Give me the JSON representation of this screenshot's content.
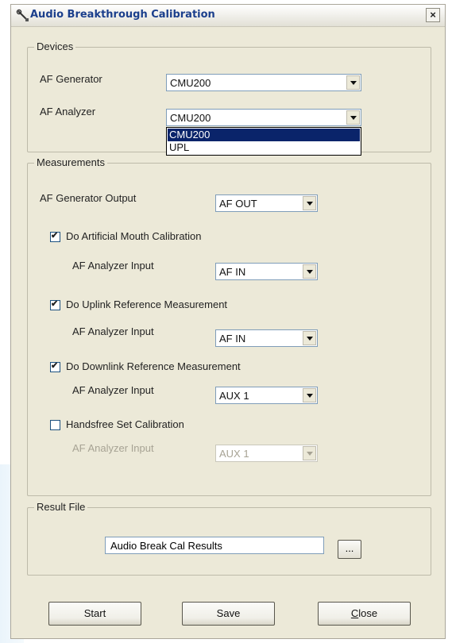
{
  "window": {
    "title": "Audio Breakthrough Calibration",
    "close_symbol": "×"
  },
  "devices": {
    "group_label": "Devices",
    "generator_label": "AF Generator",
    "generator_value": "CMU200",
    "analyzer_label": "AF Analyzer",
    "analyzer_value": "CMU200",
    "analyzer_options": [
      "CMU200",
      "UPL"
    ]
  },
  "measurements": {
    "group_label": "Measurements",
    "gen_output_label": "AF Generator Output",
    "gen_output_value": "AF OUT",
    "items": [
      {
        "label": "Do Artificial Mouth Calibration",
        "checked": true,
        "input_label": "AF Analyzer Input",
        "input_value": "AF IN",
        "enabled": true
      },
      {
        "label": "Do Uplink Reference Measurement",
        "checked": true,
        "input_label": "AF Analyzer Input",
        "input_value": "AF IN",
        "enabled": true
      },
      {
        "label": "Do Downlink Reference Measurement",
        "checked": true,
        "input_label": "AF Analyzer Input",
        "input_value": "AUX 1",
        "enabled": true
      },
      {
        "label": "Handsfree Set Calibration",
        "checked": false,
        "input_label": "AF Analyzer Input",
        "input_value": "AUX 1",
        "enabled": false
      }
    ]
  },
  "result_file": {
    "group_label": "Result File",
    "value": "Audio Break Cal Results",
    "browse_label": "..."
  },
  "buttons": {
    "start": "Start",
    "save": "Save",
    "close_first": "C",
    "close_rest": "lose"
  },
  "colors": {
    "selection": "#0a246a",
    "dialog_bg": "#ece9d8",
    "title_text": "#1b3f8c"
  },
  "icons": {
    "app": "tools-icon",
    "close": "close-icon",
    "arrow": "chevron-down-icon",
    "check": "checkmark-icon"
  }
}
